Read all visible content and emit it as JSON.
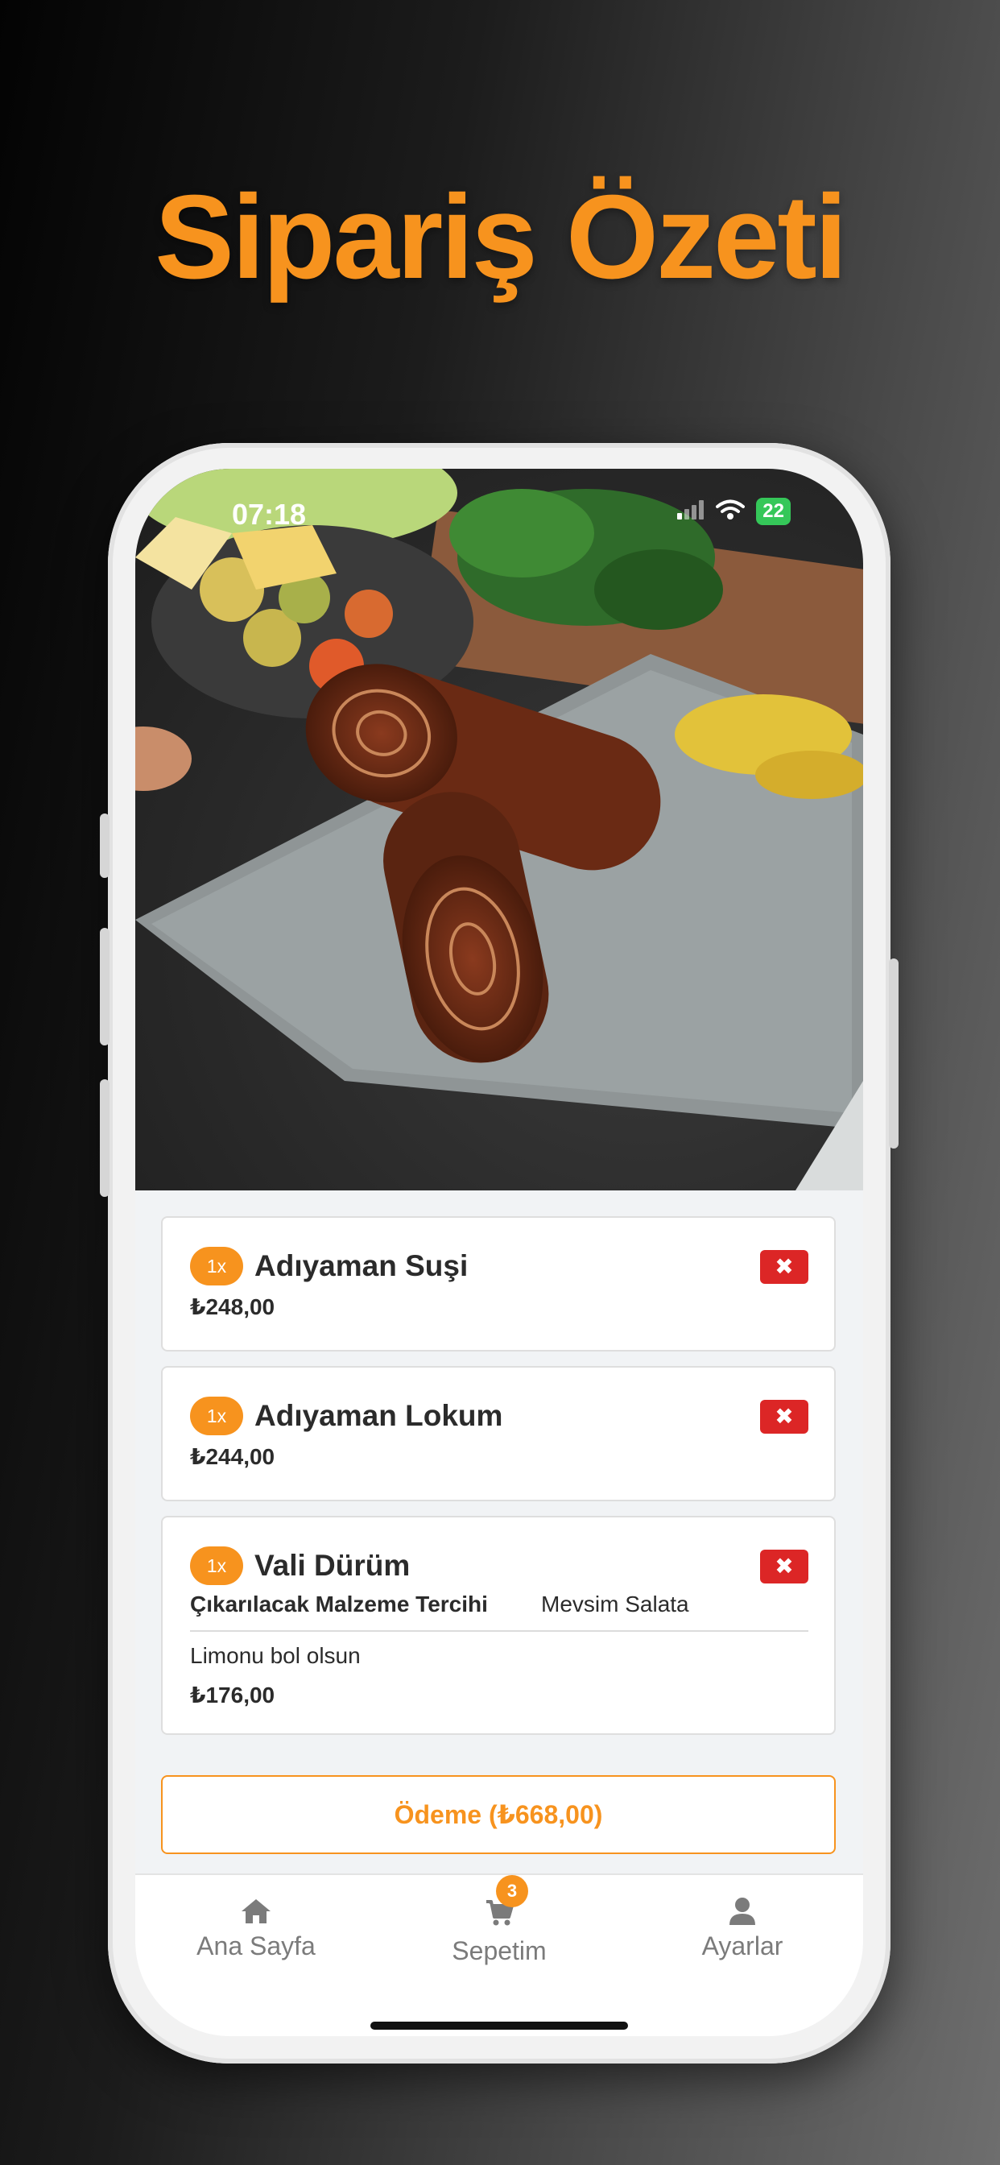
{
  "headline": "Sipariş Özeti",
  "status_bar": {
    "time": "07:18",
    "battery": "22"
  },
  "hero_image": {
    "subject": "food-photo"
  },
  "cart_items": [
    {
      "qty": "1x",
      "name": "Adıyaman Suşi",
      "price": "₺248,00",
      "remove_icon": "times-icon"
    },
    {
      "qty": "1x",
      "name": "Adıyaman Lokum",
      "price": "₺244,00",
      "remove_icon": "times-icon"
    },
    {
      "qty": "1x",
      "name": "Vali Dürüm",
      "option_label": "Çıkarılacak Malzeme Tercihi",
      "option_value": "Mevsim Salata",
      "note": "Limonu bol olsun",
      "price": "₺176,00",
      "remove_icon": "times-icon"
    }
  ],
  "checkout_button": "Ödeme (₺668,00)",
  "tabbar": {
    "tabs": [
      {
        "label": "Ana Sayfa",
        "icon": "home-icon"
      },
      {
        "label": "Sepetim",
        "icon": "cart-icon",
        "badge": "3"
      },
      {
        "label": "Ayarlar",
        "icon": "user-icon"
      }
    ]
  },
  "colors": {
    "accent": "#f7931e",
    "danger": "#dc2626",
    "text": "#2b2b2b",
    "muted": "#7b7b7b"
  }
}
